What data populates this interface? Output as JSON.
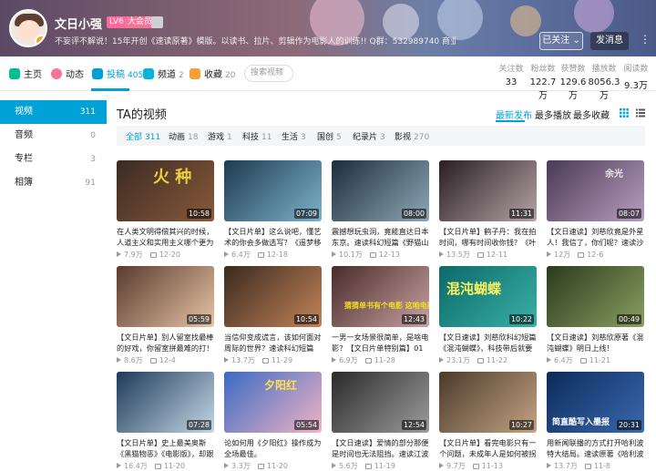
{
  "header": {
    "username": "文日小强",
    "level_tag": "LV6",
    "vip_tag": "大会员",
    "square_tag": "",
    "signature": "不妄评不解说！15年开创《速读原著》模版。以读书、拉片、剪辑作为电影人的训练!! Q群：532989740 商业合作Q：176829690",
    "follow_label": "已关注",
    "follow_caret": "⌄",
    "message_label": "发消息",
    "more_label": "⋮"
  },
  "nav": {
    "items": [
      {
        "label": "主页",
        "count": "",
        "icon_color": "#00c091"
      },
      {
        "label": "动态",
        "count": "",
        "icon_color": "#fb7299"
      },
      {
        "label": "投稿",
        "count": "405",
        "icon_color": "#00a1d6",
        "active": true
      },
      {
        "label": "频道",
        "count": "2",
        "icon_color": "#02b5da"
      },
      {
        "label": "收藏",
        "count": "20",
        "icon_color": "#f3a034"
      }
    ],
    "search_placeholder": "搜索视频",
    "stats": [
      {
        "label": "关注数",
        "value": "33"
      },
      {
        "label": "粉丝数",
        "value": "122.7万"
      },
      {
        "label": "获赞数",
        "value": "129.6万"
      },
      {
        "label": "播放数",
        "value": "8056.3万"
      },
      {
        "label": "阅读数",
        "value": "9.3万"
      }
    ]
  },
  "sidebar": {
    "items": [
      {
        "label": "视频",
        "count": "311",
        "active": true
      },
      {
        "label": "音频",
        "count": "0"
      },
      {
        "label": "专栏",
        "count": "3"
      },
      {
        "label": "相簿",
        "count": "91"
      }
    ]
  },
  "main": {
    "title": "TA的视频",
    "sorts": [
      {
        "label": "最新发布",
        "active": true
      },
      {
        "label": "最多播放"
      },
      {
        "label": "最多收藏"
      }
    ],
    "filters": [
      {
        "label": "全部",
        "count": "311",
        "active": true
      },
      {
        "label": "动画",
        "count": "18"
      },
      {
        "label": "游戏",
        "count": "1"
      },
      {
        "label": "科技",
        "count": "11"
      },
      {
        "label": "生活",
        "count": "3"
      },
      {
        "label": "国创",
        "count": "5"
      },
      {
        "label": "纪录片",
        "count": "3"
      },
      {
        "label": "影视",
        "count": "270"
      }
    ],
    "videos": [
      {
        "duration": "10:58",
        "title": "在人类文明得偿其兴的时候，人道主义和实用主义哪个更为重要？该",
        "plays": "7.9万",
        "date": "12-20",
        "thumb_text": "火 种",
        "colors": [
          "#3a2a22",
          "#8a5a3a"
        ]
      },
      {
        "duration": "07:09",
        "title": "【文日片单】这么说吧，懂艺术的你会多做选写？《遥梦移花队》",
        "plays": "6.4万",
        "date": "12-18",
        "thumb_text": "",
        "colors": [
          "#1e3b52",
          "#7db2c9"
        ]
      },
      {
        "duration": "08:00",
        "title": "震撼想玩虫洞，竟能直达日本东京。速读科幻短篇《野猫山——东京",
        "plays": "10.1万",
        "date": "12-13",
        "thumb_text": "",
        "colors": [
          "#1c2d3b",
          "#8fa8b8"
        ]
      },
      {
        "duration": "11:31",
        "title": "【文日片单】鹤子丹：我在拍时间，哪有时间收你钱？《叶问1-",
        "plays": "13.5万",
        "date": "12-11",
        "thumb_text": "",
        "colors": [
          "#2a1e22",
          "#b4a4a8"
        ]
      },
      {
        "duration": "08:07",
        "title": "【文日速读】刘慈欣竟是外星人！我信了，你们呢？速读沙雕科幻",
        "plays": "12万",
        "date": "12-6",
        "thumb_text": "余光",
        "colors": [
          "#4a3a52",
          "#b89ec2"
        ]
      },
      {
        "duration": "05:59",
        "title": "【文日片单】别人留室找最棒的好戏，你留室拼最难的打！《勇敢者",
        "plays": "8.6万",
        "date": "12-4",
        "thumb_text": "",
        "colors": [
          "#5a3a2e",
          "#e6c4a4"
        ]
      },
      {
        "duration": "10:54",
        "title": "当信仰变成谎言，该如何面对周际的世界？速读科幻短篇《蚀花》原",
        "plays": "13.7万",
        "date": "11-29",
        "thumb_text": "",
        "colors": [
          "#3a2a1e",
          "#c2845a"
        ]
      },
      {
        "duration": "12:43",
        "title": "一男一女场景很简单，是啥电影？【文日片单特别篇】01",
        "plays": "6.9万",
        "date": "11-28",
        "thumb_text": "猜猜单书有个电影 这咱电影？",
        "colors": [
          "#4a2a2a",
          "#c9a2a2"
        ]
      },
      {
        "duration": "10:22",
        "title": "【文日速读】刘慈欣科幻短篇《混沌蝴蝶》，科技带后就要拯灭了，复",
        "plays": "23.1万",
        "date": "11-22",
        "thumb_text": "混沌蝴蝶",
        "colors": [
          "#0c6a6a",
          "#39b0a4"
        ]
      },
      {
        "duration": "00:49",
        "title": "【文日速读】刘慈欣原著《混沌蝴蝶》明日上线！",
        "plays": "6.4万",
        "date": "11-21",
        "thumb_text": "",
        "colors": [
          "#2c3a1e",
          "#8aa060"
        ]
      },
      {
        "duration": "07:28",
        "title": "【文日片单】史上最美奥斯《黑猫物恶》《电影版》，却跟原著差233",
        "plays": "16.4万",
        "date": "11-20",
        "thumb_text": "",
        "colors": [
          "#1e3a5a",
          "#c4d8e6"
        ]
      },
      {
        "duration": "05:54",
        "title": "论如何用《夕阳红》操作成为全场最佳。",
        "plays": "3.3万",
        "date": "11-20",
        "thumb_text": "夕阳红",
        "colors": [
          "#3a6ac4",
          "#f0b4c4"
        ]
      },
      {
        "duration": "12:54",
        "title": "【文日速读】爱情的部分那便是时间也无法阻挡。速读江波《曼伍相",
        "plays": "5.6万",
        "date": "11-19",
        "thumb_text": "",
        "colors": [
          "#2a2a2a",
          "#9c9c9c"
        ]
      },
      {
        "duration": "10:27",
        "title": "【文日片单】看完电影只有一个问题，未成年人是如何被拐骗的？",
        "plays": "9.7万",
        "date": "11-13",
        "thumb_text": "",
        "colors": [
          "#4a3a2a",
          "#c4a484"
        ]
      },
      {
        "duration": "20:31",
        "title": "用新闻联播的方式打开哈利波特大结局。速读原著《哈利波特与死亡",
        "plays": "13.7万",
        "date": "11-8",
        "thumb_text": "简直酷写入墨报",
        "colors": [
          "#0c2a5a",
          "#3a6ab0"
        ]
      }
    ]
  }
}
